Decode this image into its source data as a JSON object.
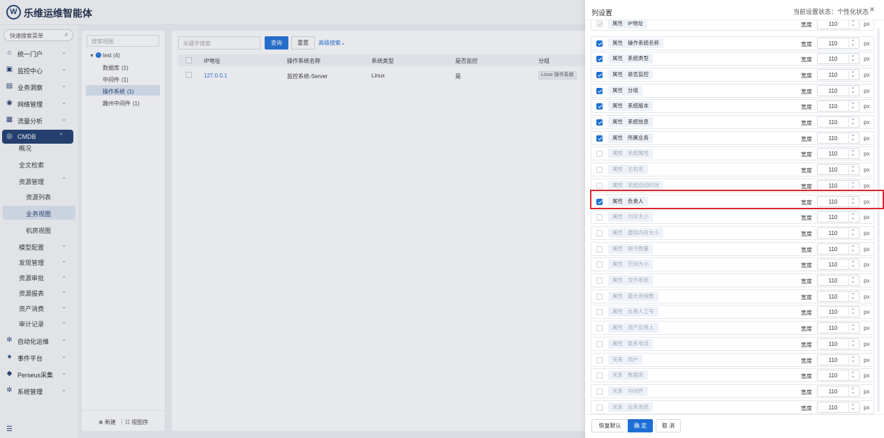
{
  "app": {
    "title": "乐维运维智能体",
    "logo_letter": "W"
  },
  "sidebar": {
    "search_placeholder": "快速搜索菜单",
    "menu": [
      {
        "label": "统一门户",
        "icon": "home-icon"
      },
      {
        "label": "监控中心",
        "icon": "monitor-icon"
      },
      {
        "label": "业务洞察",
        "icon": "insight-icon"
      },
      {
        "label": "网络管理",
        "icon": "network-icon"
      },
      {
        "label": "流量分析",
        "icon": "traffic-icon"
      },
      {
        "label": "CMDB",
        "icon": "cmdb-icon",
        "active": true
      }
    ],
    "cmdb_children": [
      {
        "label": "概况"
      },
      {
        "label": "全文检索"
      },
      {
        "label": "资源管理",
        "expanded": true
      },
      {
        "label": "资源列表"
      },
      {
        "label": "业务视图",
        "selected": true
      },
      {
        "label": "机房视图"
      },
      {
        "label": "模型配置"
      },
      {
        "label": "发现管理"
      },
      {
        "label": "资源审批"
      },
      {
        "label": "资源报表"
      },
      {
        "label": "资产消费"
      },
      {
        "label": "审计记录"
      }
    ],
    "bottom_menu": [
      {
        "label": "自动化运维",
        "icon": "gear-icon"
      },
      {
        "label": "事件平台",
        "icon": "bell-icon"
      },
      {
        "label": "Perseus采集",
        "icon": "diamond-icon"
      },
      {
        "label": "系统管理",
        "icon": "settings-icon"
      }
    ]
  },
  "tree": {
    "search_placeholder": "搜索视图",
    "root": "test",
    "root_count": "(4)",
    "children": [
      {
        "label": "数据库",
        "count": "(1)"
      },
      {
        "label": "中间件",
        "count": "(1)"
      },
      {
        "label": "操作系统",
        "count": "(1)",
        "selected": true
      },
      {
        "label": "趣州中间件",
        "count": "(1)"
      }
    ],
    "new_label": "新建",
    "sort_label": "视图序"
  },
  "main": {
    "keyword_placeholder": "关键字搜索",
    "query_label": "查询",
    "reset_label": "重置",
    "advanced_label": "高级搜索",
    "columns": [
      "IP地址",
      "操作系统名称",
      "系统类型",
      "是否监控",
      "分组"
    ],
    "rows": [
      {
        "ip": "127.0.0.1",
        "os_name": "监控系统-Server",
        "os_type": "Linux",
        "monitored": "是",
        "group": "Linux 操作系统"
      }
    ]
  },
  "drawer": {
    "title": "列设置",
    "status_label": "当前设置状态：个性化状态",
    "width_label": "宽度",
    "unit": "px",
    "items": [
      {
        "type": "属性",
        "name": "IP地址",
        "checked": true,
        "disabled": true,
        "width": "110"
      },
      {
        "type": "属性",
        "name": "操作系统名称",
        "checked": true,
        "width": "110"
      },
      {
        "type": "属性",
        "name": "系统类型",
        "checked": true,
        "width": "110"
      },
      {
        "type": "属性",
        "name": "是否监控",
        "checked": true,
        "width": "110"
      },
      {
        "type": "属性",
        "name": "分组",
        "checked": true,
        "width": "110"
      },
      {
        "type": "属性",
        "name": "系统版本",
        "checked": true,
        "width": "110"
      },
      {
        "type": "属性",
        "name": "系统信息",
        "checked": true,
        "width": "110"
      },
      {
        "type": "属性",
        "name": "所属业务",
        "checked": true,
        "width": "110"
      },
      {
        "type": "属性",
        "name": "系统属性",
        "checked": false,
        "width": "110"
      },
      {
        "type": "属性",
        "name": "主机名",
        "checked": false,
        "width": "110"
      },
      {
        "type": "属性",
        "name": "系统启动时间",
        "checked": false,
        "width": "110"
      },
      {
        "type": "属性",
        "name": "负责人",
        "checked": true,
        "width": "110",
        "highlighted": true
      },
      {
        "type": "属性",
        "name": "内存大小",
        "checked": false,
        "width": "110"
      },
      {
        "type": "属性",
        "name": "虚拟内存大小",
        "checked": false,
        "width": "110"
      },
      {
        "type": "属性",
        "name": "网卡数量",
        "checked": false,
        "width": "110"
      },
      {
        "type": "属性",
        "name": "空间大小",
        "checked": false,
        "width": "110"
      },
      {
        "type": "属性",
        "name": "文件系统",
        "checked": false,
        "width": "110"
      },
      {
        "type": "属性",
        "name": "最大进程数",
        "checked": false,
        "width": "110"
      },
      {
        "type": "属性",
        "name": "负责人工号",
        "checked": false,
        "width": "110"
      },
      {
        "type": "属性",
        "name": "资产负责人",
        "checked": false,
        "width": "110"
      },
      {
        "type": "属性",
        "name": "联系电话",
        "checked": false,
        "width": "110"
      },
      {
        "type": "关系",
        "name": "用户",
        "checked": false,
        "width": "110"
      },
      {
        "type": "关系",
        "name": "数据库",
        "checked": false,
        "width": "110"
      },
      {
        "type": "关系",
        "name": "中间件",
        "checked": false,
        "width": "110"
      },
      {
        "type": "关系",
        "name": "业务系统",
        "checked": false,
        "width": "110"
      }
    ],
    "footer": {
      "restore_label": "恢复默认",
      "ok_label": "确 定",
      "cancel_label": "取 消"
    }
  },
  "colors": {
    "primary": "#1d6fd6",
    "nav_active": "#1d3b6e",
    "highlight": "#d9262c"
  }
}
